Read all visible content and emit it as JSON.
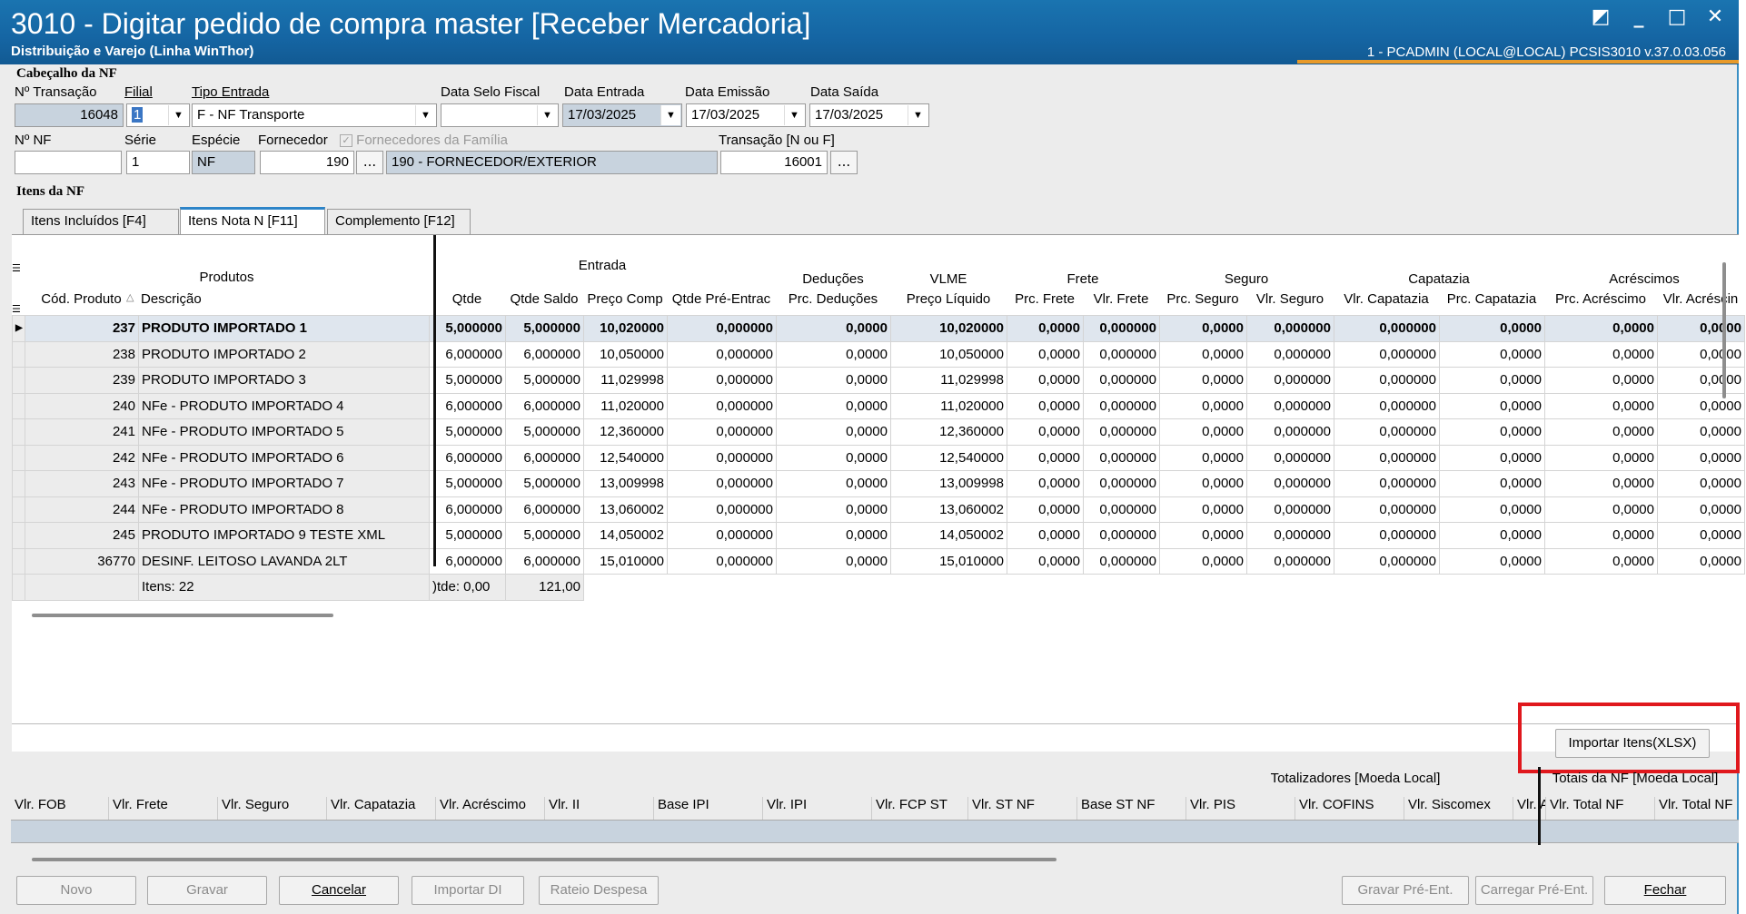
{
  "window": {
    "title": "3010 - Digitar pedido de compra master [Receber Mercadoria]",
    "subtitle": "Distribuição e Varejo (Linha WinThor)",
    "user_info": "1 - PCADMIN (LOCAL@LOCAL)  PCSIS3010  v.37.0.03.056",
    "controls": [
      "◩",
      "_",
      "□",
      "✕"
    ]
  },
  "header": {
    "section_title": "Cabeçalho da NF",
    "labels": {
      "transacao": "Nº Transação",
      "filial": "Filial",
      "tipo_entrada": "Tipo Entrada",
      "data_selo": "Data Selo Fiscal",
      "data_entrada": "Data Entrada",
      "data_emissao": "Data Emissão",
      "data_saida": "Data Saída",
      "nf": "Nº NF",
      "serie": "Série",
      "especie": "Espécie",
      "fornecedor": "Fornecedor",
      "fornecedores_familia": "Fornecedores da Família",
      "transacao_nf": "Transação [N ou F]"
    },
    "values": {
      "transacao": "16048",
      "filial": "1",
      "tipo_entrada": "F - NF Transporte",
      "data_selo": "",
      "data_entrada": "17/03/2025",
      "data_emissao": "17/03/2025",
      "data_saida": "17/03/2025",
      "nf": "",
      "serie": "1",
      "especie": "NF",
      "fornecedor_code": "190",
      "fornecedor_name": "190 - FORNECEDOR/EXTERIOR",
      "transacao_nf": "16001"
    },
    "ellipsis": "..."
  },
  "items": {
    "section_title": "Itens da NF",
    "tabs": [
      "Itens Incluídos [F4]",
      "Itens Nota N [F11]",
      "Complemento [F12]"
    ],
    "groups": [
      "Produtos",
      "Entrada",
      "Deduções",
      "VLME",
      "Frete",
      "Seguro",
      "Capatazia",
      "Acréscimos"
    ],
    "columns": [
      "Cód. Produto",
      "Descrição",
      "Qtde",
      "Qtde Saldo",
      "Preço Comp",
      "Qtde Pré-Entrac",
      "Prc. Deduções",
      "Preço Líquido",
      "Prc. Frete",
      "Vlr. Frete",
      "Prc. Seguro",
      "Vlr. Seguro",
      "Vlr. Capatazia",
      "Prc. Capatazia",
      "Prc. Acréscimo",
      "Vlr. Acréscin"
    ],
    "rows": [
      [
        "237",
        "PRODUTO IMPORTADO 1",
        "5,000000",
        "5,000000",
        "10,020000",
        "0,000000",
        "0,0000",
        "10,020000",
        "0,0000",
        "0,000000",
        "0,0000",
        "0,000000",
        "0,000000",
        "0,0000",
        "0,0000",
        "0,0000"
      ],
      [
        "238",
        "PRODUTO IMPORTADO 2",
        "6,000000",
        "6,000000",
        "10,050000",
        "0,000000",
        "0,0000",
        "10,050000",
        "0,0000",
        "0,000000",
        "0,0000",
        "0,000000",
        "0,000000",
        "0,0000",
        "0,0000",
        "0,0000"
      ],
      [
        "239",
        "PRODUTO IMPORTADO 3",
        "5,000000",
        "5,000000",
        "11,029998",
        "0,000000",
        "0,0000",
        "11,029998",
        "0,0000",
        "0,000000",
        "0,0000",
        "0,000000",
        "0,000000",
        "0,0000",
        "0,0000",
        "0,0000"
      ],
      [
        "240",
        "NFe - PRODUTO IMPORTADO 4",
        "6,000000",
        "6,000000",
        "11,020000",
        "0,000000",
        "0,0000",
        "11,020000",
        "0,0000",
        "0,000000",
        "0,0000",
        "0,000000",
        "0,000000",
        "0,0000",
        "0,0000",
        "0,0000"
      ],
      [
        "241",
        "NFe - PRODUTO IMPORTADO 5",
        "5,000000",
        "5,000000",
        "12,360000",
        "0,000000",
        "0,0000",
        "12,360000",
        "0,0000",
        "0,000000",
        "0,0000",
        "0,000000",
        "0,000000",
        "0,0000",
        "0,0000",
        "0,0000"
      ],
      [
        "242",
        "NFe - PRODUTO IMPORTADO 6",
        "6,000000",
        "6,000000",
        "12,540000",
        "0,000000",
        "0,0000",
        "12,540000",
        "0,0000",
        "0,000000",
        "0,0000",
        "0,000000",
        "0,000000",
        "0,0000",
        "0,0000",
        "0,0000"
      ],
      [
        "243",
        "NFe - PRODUTO IMPORTADO 7",
        "5,000000",
        "5,000000",
        "13,009998",
        "0,000000",
        "0,0000",
        "13,009998",
        "0,0000",
        "0,000000",
        "0,0000",
        "0,000000",
        "0,000000",
        "0,0000",
        "0,0000",
        "0,0000"
      ],
      [
        "244",
        "NFe - PRODUTO IMPORTADO 8",
        "6,000000",
        "6,000000",
        "13,060002",
        "0,000000",
        "0,0000",
        "13,060002",
        "0,0000",
        "0,000000",
        "0,0000",
        "0,000000",
        "0,000000",
        "0,0000",
        "0,0000",
        "0,0000"
      ],
      [
        "245",
        "PRODUTO IMPORTADO 9 TESTE XML",
        "5,000000",
        "5,000000",
        "14,050002",
        "0,000000",
        "0,0000",
        "14,050002",
        "0,0000",
        "0,000000",
        "0,0000",
        "0,000000",
        "0,000000",
        "0,0000",
        "0,0000",
        "0,0000"
      ],
      [
        "36770",
        "DESINF. LEITOSO LAVANDA 2LT",
        "6,000000",
        "6,000000",
        "15,010000",
        "0,000000",
        "0,0000",
        "15,010000",
        "0,0000",
        "0,000000",
        "0,0000",
        "0,000000",
        "0,000000",
        "0,0000",
        "0,0000",
        "0,0000"
      ]
    ],
    "footer": {
      "itens": "Itens: 22",
      "qtde": ")tde: 0,00",
      "saldo": "121,00"
    },
    "import_button": "Importar Itens(XLSX)"
  },
  "totals": {
    "group_local": "Totalizadores [Moeda Local]",
    "group_nf": "Totais da NF [Moeda Local]",
    "columns": [
      "Vlr. FOB",
      "Vlr. Frete",
      "Vlr. Seguro",
      "Vlr. Capatazia",
      "Vlr. Acréscimo",
      "Vlr. II",
      "Base IPI",
      "Vlr. IPI",
      "Vlr. FCP ST",
      "Vlr. ST NF",
      "Base ST NF",
      "Vlr. PIS",
      "Vlr. COFINS",
      "Vlr. Siscomex",
      "Vlr. A",
      "Vlr. Total NF",
      "Vlr. Total NF"
    ]
  },
  "buttons": {
    "novo": "Novo",
    "gravar": "Gravar",
    "cancelar": "Cancelar",
    "importar_di": "Importar DI",
    "rateio": "Rateio Despesa",
    "gravar_pre": "Gravar Pré-Ent.",
    "carregar_pre": "Carregar Pré-Ent.",
    "fechar": "Fechar"
  }
}
